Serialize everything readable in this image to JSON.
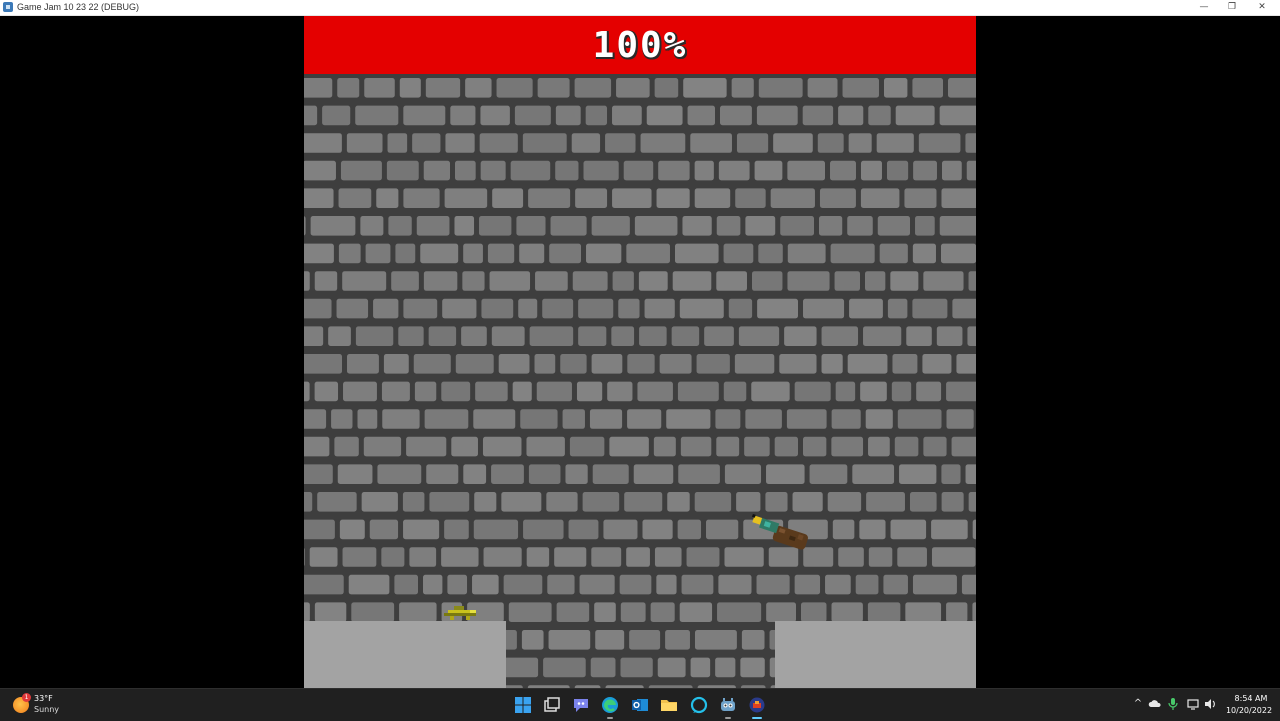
{
  "window": {
    "title": "Game Jam 10 23 22 (DEBUG)",
    "minimize_glyph": "—",
    "maximize_glyph": "❐",
    "close_glyph": "✕"
  },
  "game": {
    "hud_text": "100%",
    "hud_color": "#e40000",
    "brick_color": "#7d7d7d",
    "mortar_color": "#3e3e3e",
    "platform_color": "#a3a3a3",
    "player": {
      "icon": "yellow-ship-icon"
    },
    "enemy": {
      "icon": "brown-creature-icon"
    }
  },
  "taskbar": {
    "weather": {
      "temperature": "33°F",
      "condition": "Sunny",
      "badge": "1",
      "icon": "sun-weather-icon"
    },
    "apps": [
      {
        "name": "start-button",
        "icon": "windows-logo-icon"
      },
      {
        "name": "task-view-button",
        "icon": "task-view-icon"
      },
      {
        "name": "teams-chat-button",
        "icon": "teams-chat-icon"
      },
      {
        "name": "edge-button",
        "icon": "edge-browser-icon"
      },
      {
        "name": "outlook-button",
        "icon": "outlook-icon"
      },
      {
        "name": "file-explorer-button",
        "icon": "folder-icon"
      },
      {
        "name": "alexa-button",
        "icon": "alexa-icon"
      },
      {
        "name": "godot-button",
        "icon": "godot-engine-icon"
      },
      {
        "name": "game-window-button",
        "icon": "game-app-icon"
      }
    ],
    "tray": {
      "chevron": "^",
      "icons": [
        "onedrive-cloud-icon",
        "microphone-icon",
        "network-icon",
        "volume-icon"
      ]
    },
    "clock": {
      "time": "8:54 AM",
      "date": "10/20/2022"
    }
  }
}
